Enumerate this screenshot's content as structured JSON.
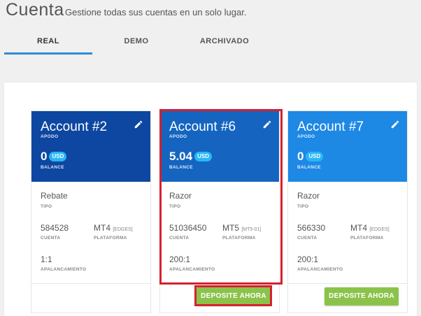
{
  "header": {
    "title": "Cuenta",
    "subtitle": "Gestione todas sus cuentas en un solo lugar."
  },
  "tabs": [
    {
      "label": "REAL",
      "active": true
    },
    {
      "label": "DEMO",
      "active": false
    },
    {
      "label": "ARCHIVADO",
      "active": false
    }
  ],
  "labels": {
    "apodo": "APODO",
    "balance": "BALANCE",
    "tipo": "TIPO",
    "cuenta": "CUENTA",
    "plataforma": "PLATAFORMA",
    "apalancamiento": "APALANCAMIENTO",
    "currency": "USD"
  },
  "cards": [
    {
      "title": "Account #2",
      "balance": "0",
      "tipo": "Rebate",
      "cuenta": "584528",
      "plataforma": "MT4",
      "plataforma_server": "[EDGES]",
      "apalancamiento": "1:1",
      "head_color": "#0d47a1",
      "deposit_label": ""
    },
    {
      "title": "Account #6",
      "balance": "5.04",
      "tipo": "Razor",
      "cuenta": "51036450",
      "plataforma": "MT5",
      "plataforma_server": "[MT5-01]",
      "apalancamiento": "200:1",
      "head_color": "#1565c0",
      "deposit_label": "DEPOSITE AHORA"
    },
    {
      "title": "Account #7",
      "balance": "0",
      "tipo": "Razor",
      "cuenta": "566330",
      "plataforma": "MT4",
      "plataforma_server": "[EDGES]",
      "apalancamiento": "200:1",
      "head_color": "#1e88e5",
      "deposit_label": "DEPOSITE AHORA"
    }
  ],
  "colors": {
    "accent": "#2b8cd8",
    "deposit_green": "#8bc34a",
    "highlight_red": "#d7202e"
  }
}
